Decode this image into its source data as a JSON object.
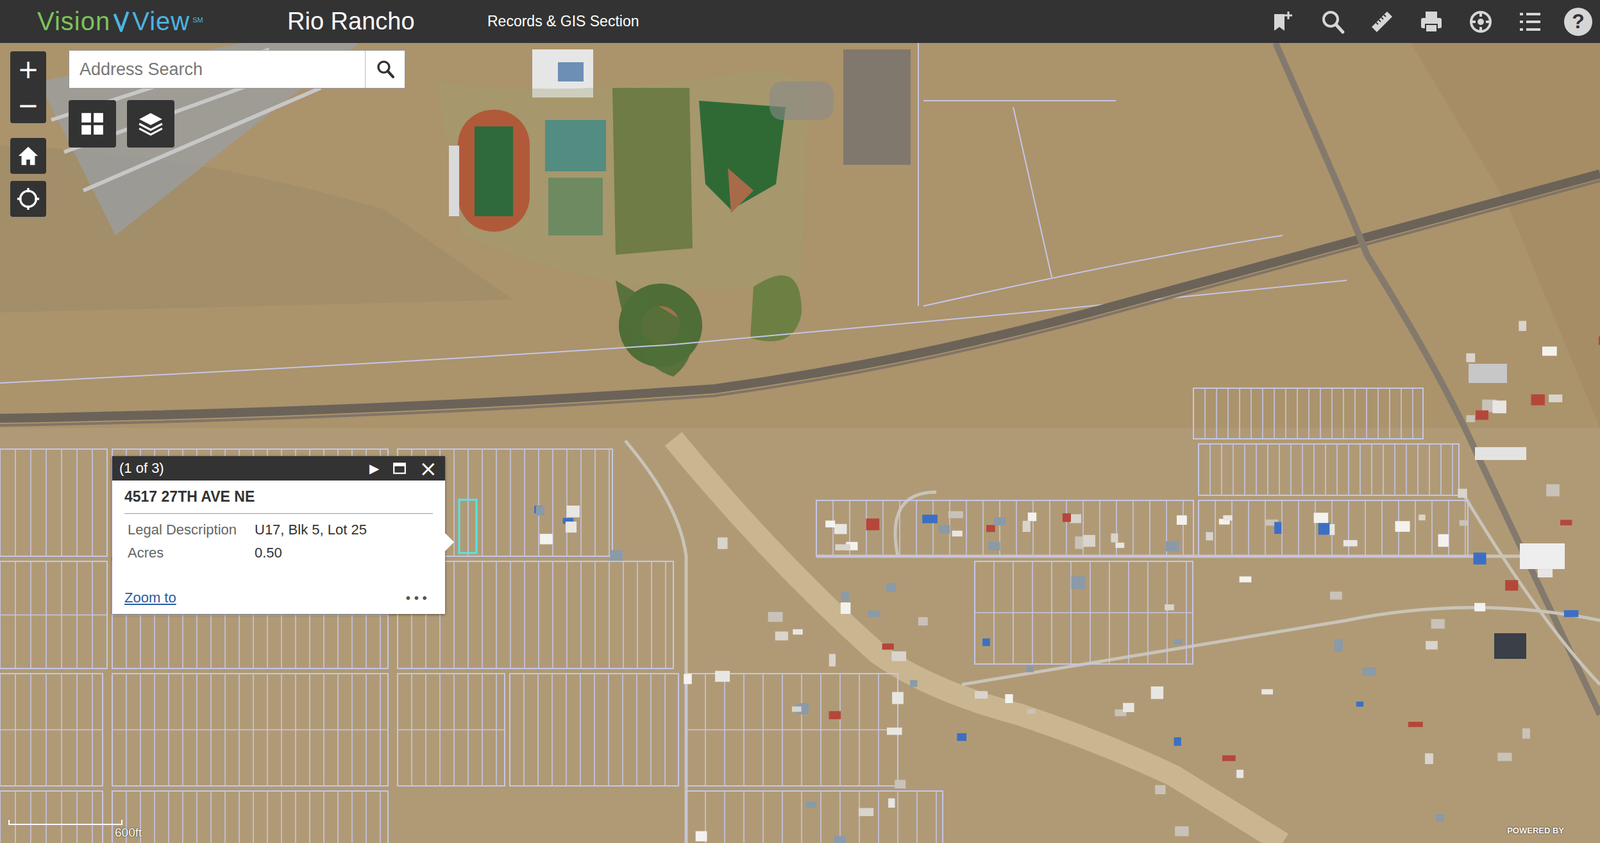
{
  "header": {
    "logo": {
      "word1": "Vision",
      "word2": "View",
      "mark": "SM"
    },
    "title": "Rio Rancho",
    "section": "Records & GIS Section",
    "help": "?"
  },
  "search": {
    "placeholder": "Address Search"
  },
  "zoom": {
    "in": "+",
    "out": "−"
  },
  "popup": {
    "counter": "(1 of 3)",
    "next": "▶",
    "close": "×",
    "title": "4517 27TH AVE NE",
    "fields": [
      {
        "label": "Legal Description",
        "value": "U17, Blk 5, Lot 25"
      },
      {
        "label": "Acres",
        "value": "0.50"
      }
    ],
    "link": "Zoom to",
    "more": "•••"
  },
  "scale": {
    "label": "600ft"
  },
  "attribution": "POWERED BY"
}
